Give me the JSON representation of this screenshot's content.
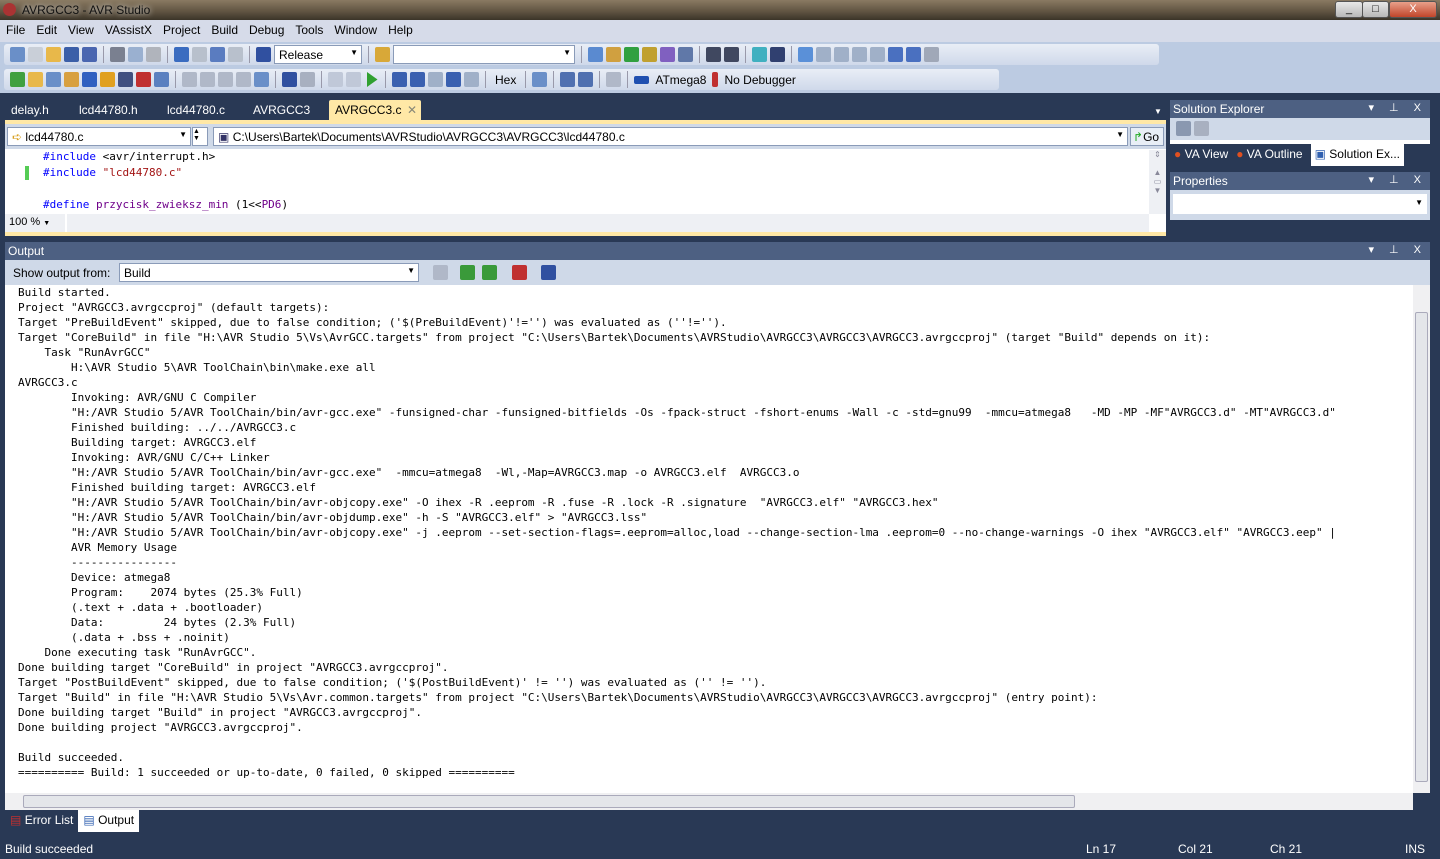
{
  "window": {
    "title": "AVRGCC3 - AVR Studio",
    "min": "_",
    "max": "□",
    "close": "X"
  },
  "menu": [
    "File",
    "Edit",
    "View",
    "VAssistX",
    "Project",
    "Build",
    "Debug",
    "Tools",
    "Window",
    "Help"
  ],
  "toolbar": {
    "config": "Release",
    "search": "",
    "hex": "Hex",
    "device": "ATmega8",
    "debugger": "No Debugger"
  },
  "doc_tabs": [
    "delay.h",
    "lcd44780.h",
    "lcd44780.c",
    "AVRGCC3",
    "AVRGCC3.c"
  ],
  "doc_tab_close": "✕",
  "editor": {
    "scope": "lcd44780.c",
    "path": "C:\\Users\\Bartek\\Documents\\AVRStudio\\AVRGCC3\\AVRGCC3\\lcd44780.c",
    "go": "Go",
    "zoom": "100 %",
    "lines": [
      {
        "kw": "#include",
        "rest": " <avr/interrupt.h>"
      },
      {
        "kw": "#include",
        "rest": " \"lcd44780.c\""
      },
      {
        "kw": "#define",
        "mac": " przycisk_zwieksz_min",
        "rest": " (1<<",
        "mac2": "PD6",
        ")": ")"
      }
    ]
  },
  "solution_explorer": {
    "title": "Solution Explorer",
    "tabs": [
      "VA View",
      "VA Outline",
      "Solution Ex..."
    ]
  },
  "properties": {
    "title": "Properties"
  },
  "output": {
    "title": "Output",
    "show_from_label": "Show output from:",
    "source": "Build",
    "lines": [
      "Build started.",
      "Project \"AVRGCC3.avrgccproj\" (default targets):",
      "Target \"PreBuildEvent\" skipped, due to false condition; ('$(PreBuildEvent)'!='') was evaluated as (''!='').",
      "Target \"CoreBuild\" in file \"H:\\AVR Studio 5\\Vs\\AvrGCC.targets\" from project \"C:\\Users\\Bartek\\Documents\\AVRStudio\\AVRGCC3\\AVRGCC3\\AVRGCC3.avrgccproj\" (target \"Build\" depends on it):",
      "    Task \"RunAvrGCC\"",
      "        H:\\AVR Studio 5\\AVR ToolChain\\bin\\make.exe all",
      "AVRGCC3.c",
      "        Invoking: AVR/GNU C Compiler",
      "        \"H:/AVR Studio 5/AVR ToolChain/bin/avr-gcc.exe\" -funsigned-char -funsigned-bitfields -Os -fpack-struct -fshort-enums -Wall -c -std=gnu99  -mmcu=atmega8   -MD -MP -MF\"AVRGCC3.d\" -MT\"AVRGCC3.d\"",
      "        Finished building: ../../AVRGCC3.c",
      "        Building target: AVRGCC3.elf",
      "        Invoking: AVR/GNU C/C++ Linker",
      "        \"H:/AVR Studio 5/AVR ToolChain/bin/avr-gcc.exe\"  -mmcu=atmega8  -Wl,-Map=AVRGCC3.map -o AVRGCC3.elf  AVRGCC3.o",
      "        Finished building target: AVRGCC3.elf",
      "        \"H:/AVR Studio 5/AVR ToolChain/bin/avr-objcopy.exe\" -O ihex -R .eeprom -R .fuse -R .lock -R .signature  \"AVRGCC3.elf\" \"AVRGCC3.hex\"",
      "        \"H:/AVR Studio 5/AVR ToolChain/bin/avr-objdump.exe\" -h -S \"AVRGCC3.elf\" > \"AVRGCC3.lss\"",
      "        \"H:/AVR Studio 5/AVR ToolChain/bin/avr-objcopy.exe\" -j .eeprom --set-section-flags=.eeprom=alloc,load --change-section-lma .eeprom=0 --no-change-warnings -O ihex \"AVRGCC3.elf\" \"AVRGCC3.eep\" |",
      "        AVR Memory Usage",
      "        ----------------",
      "        Device: atmega8",
      "        Program:    2074 bytes (25.3% Full)",
      "        (.text + .data + .bootloader)",
      "        Data:         24 bytes (2.3% Full)",
      "        (.data + .bss + .noinit)",
      "    Done executing task \"RunAvrGCC\".",
      "Done building target \"CoreBuild\" in project \"AVRGCC3.avrgccproj\".",
      "Target \"PostBuildEvent\" skipped, due to false condition; ('$(PostBuildEvent)' != '') was evaluated as ('' != '').",
      "Target \"Build\" in file \"H:\\AVR Studio 5\\Vs\\Avr.common.targets\" from project \"C:\\Users\\Bartek\\Documents\\AVRStudio\\AVRGCC3\\AVRGCC3\\AVRGCC3.avrgccproj\" (entry point):",
      "Done building target \"Build\" in project \"AVRGCC3.avrgccproj\".",
      "Done building project \"AVRGCC3.avrgccproj\".",
      "",
      "Build succeeded.",
      "========== Build: 1 succeeded or up-to-date, 0 failed, 0 skipped =========="
    ]
  },
  "bottom_tabs": [
    "Error List",
    "Output"
  ],
  "status": {
    "message": "Build succeeded",
    "ln": "Ln 17",
    "col": "Col 21",
    "ch": "Ch 21",
    "mode": "INS"
  }
}
